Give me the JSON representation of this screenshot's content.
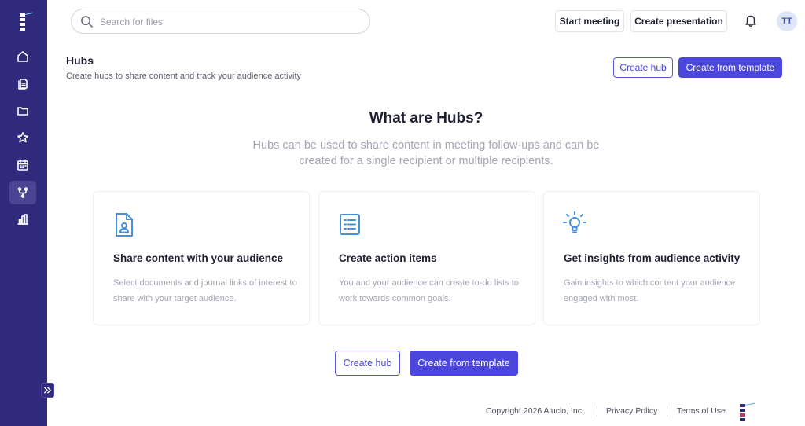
{
  "sidebar": {
    "nav": [
      {
        "icon": "home-icon"
      },
      {
        "icon": "documents-icon"
      },
      {
        "icon": "folder-icon"
      },
      {
        "icon": "star-icon"
      },
      {
        "icon": "calendar-icon"
      },
      {
        "icon": "hubs-icon",
        "active": true
      },
      {
        "icon": "analytics-icon"
      }
    ],
    "collapse_icon": "expand-chevrons-icon"
  },
  "topbar": {
    "search_placeholder": "Search for files",
    "start_meeting": "Start meeting",
    "create_presentation": "Create presentation",
    "avatar_initials": "TT"
  },
  "header": {
    "title": "Hubs",
    "subtitle": "Create hubs to share content and track your audience activity",
    "create_hub": "Create hub",
    "create_from_template": "Create from template"
  },
  "hero": {
    "title": "What are Hubs?",
    "description": "Hubs can be used to share content in meeting follow-ups and can be created for a single recipient or multiple recipients."
  },
  "cards": [
    {
      "icon": "document-person-icon",
      "title": "Share content with your audience",
      "text": "Select documents and journal links of interest to share with your target audience."
    },
    {
      "icon": "checklist-icon",
      "title": "Create action items",
      "text": "You and your audience can create to-do lists to work towards common goals."
    },
    {
      "icon": "lightbulb-icon",
      "title": "Get insights from audience activity",
      "text": "Gain insights to which content your audience engaged with most."
    }
  ],
  "actions": {
    "create_hub": "Create hub",
    "create_from_template": "Create from template"
  },
  "footer": {
    "copyright": "Copyright 2026 Alucio, Inc.",
    "privacy": "Privacy Policy",
    "terms": "Terms of Use"
  },
  "colors": {
    "sidebar": "#2f2a7b",
    "primary": "#4b46dc",
    "icon_blue": "#4a90d9"
  }
}
